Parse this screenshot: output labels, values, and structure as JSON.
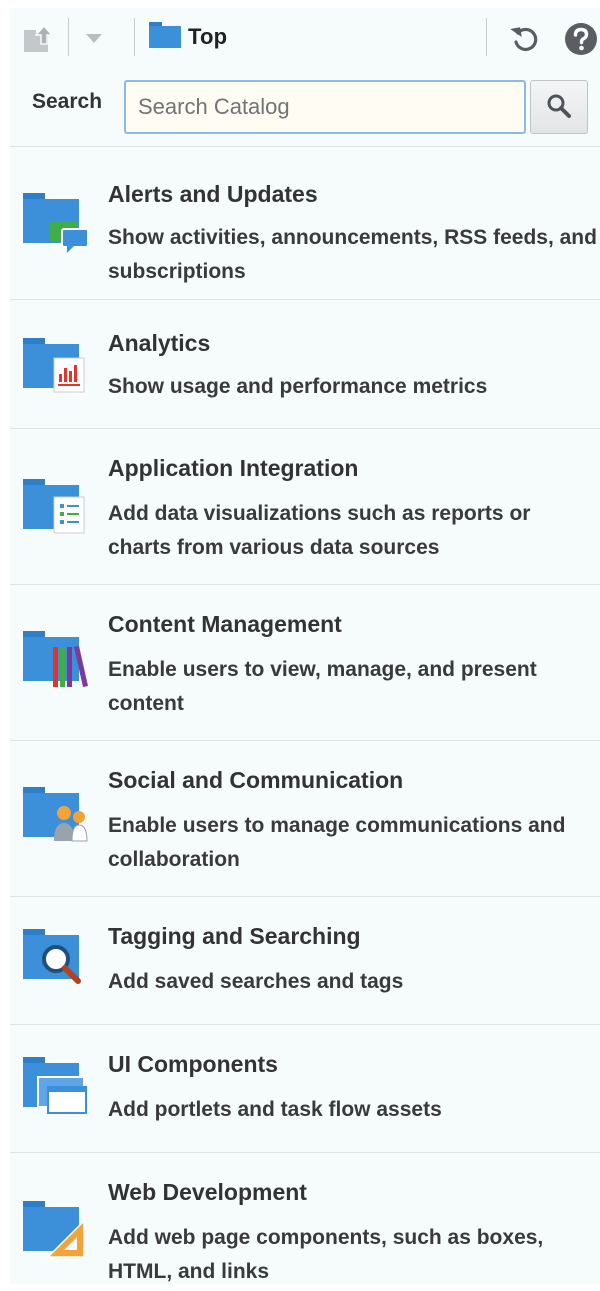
{
  "toolbar": {
    "breadcrumb_label": "Top",
    "icons": {
      "upload": "upload-to-folder-icon",
      "dropdown": "chevron-down-icon",
      "breadcrumb": "folder-icon",
      "refresh": "refresh-icon",
      "help": "help-icon"
    }
  },
  "search": {
    "label": "Search",
    "placeholder": "Search Catalog",
    "value": "",
    "button_icon": "magnifier-icon"
  },
  "catalog": {
    "items": [
      {
        "title": "Alerts and Updates",
        "description": "Show activities, announcements, RSS feeds, and subscriptions",
        "icon": "folder-alerts-icon"
      },
      {
        "title": "Analytics",
        "description": "Show usage and performance metrics",
        "icon": "folder-analytics-icon"
      },
      {
        "title": "Application Integration",
        "description": "Add data visualizations such as reports or charts from various data sources",
        "icon": "folder-integration-icon"
      },
      {
        "title": "Content Management",
        "description": "Enable users to view, manage, and present content",
        "icon": "folder-content-icon"
      },
      {
        "title": "Social and Communication",
        "description": "Enable users to manage communications and collaboration",
        "icon": "folder-social-icon"
      },
      {
        "title": "Tagging and Searching",
        "description": "Add saved searches and tags",
        "icon": "folder-search-icon"
      },
      {
        "title": "UI Components",
        "description": "Add portlets and task flow assets",
        "icon": "folder-ui-components-icon"
      },
      {
        "title": "Web Development",
        "description": "Add web page components, such as boxes, HTML, and links",
        "icon": "folder-web-development-icon"
      }
    ]
  },
  "colors": {
    "panel_background": "#f6fbfc",
    "folder_blue": "#3c8fd9",
    "input_border": "#8db9e7",
    "divider": "#dde3e5"
  }
}
